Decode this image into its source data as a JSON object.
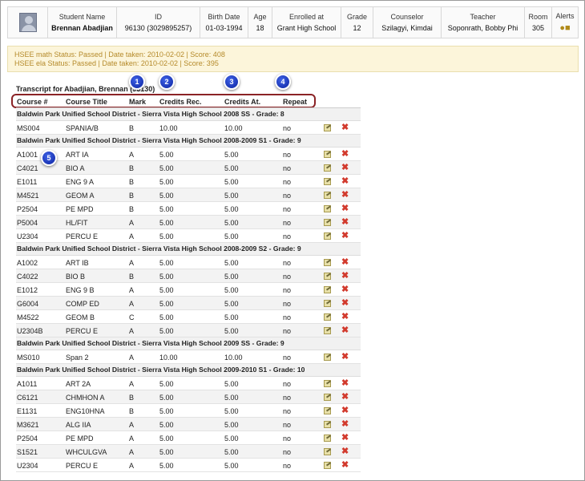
{
  "header": {
    "columns": [
      {
        "label": "Student Name",
        "value": "Brennan Abadjian"
      },
      {
        "label": "ID",
        "value": "96130 (3029895257)"
      },
      {
        "label": "Birth Date",
        "value": "01-03-1994"
      },
      {
        "label": "Age",
        "value": "18"
      },
      {
        "label": "Enrolled at",
        "value": "Grant High School"
      },
      {
        "label": "Grade",
        "value": "12"
      },
      {
        "label": "Counselor",
        "value": "Szilagyi, Kimdai"
      },
      {
        "label": "Teacher",
        "value": "Soponrath, Bobby Phi"
      },
      {
        "label": "Room",
        "value": "305"
      },
      {
        "label": "Alerts",
        "value": ""
      }
    ]
  },
  "hsee": {
    "line1": "HSEE math Status: Passed | Date taken: 2010-02-02 | Score: 408",
    "line2": "HSEE ela Status: Passed | Date taken: 2010-02-02 | Score: 395"
  },
  "transcript": {
    "title": "Transcript for Abadjian, Brennan (96130)",
    "columns": [
      "Course #",
      "Course Title",
      "Mark",
      "Credits Rec.",
      "Credits At.",
      "Repeat"
    ],
    "sections": [
      {
        "school": "Baldwin Park Unified School District - Sierra Vista High School 2008 SS - Grade: 8",
        "rows": [
          [
            "MS004",
            "SPANIA/B",
            "B",
            "10.00",
            "10.00",
            "no"
          ]
        ]
      },
      {
        "school": "Baldwin Park Unified School District - Sierra Vista High School 2008-2009 S1 - Grade: 9",
        "rows": [
          [
            "A1001",
            "ART IA",
            "A",
            "5.00",
            "5.00",
            "no"
          ],
          [
            "C4021",
            "BIO A",
            "B",
            "5.00",
            "5.00",
            "no"
          ],
          [
            "E1011",
            "ENG 9 A",
            "B",
            "5.00",
            "5.00",
            "no"
          ],
          [
            "M4521",
            "GEOM A",
            "B",
            "5.00",
            "5.00",
            "no"
          ],
          [
            "P2504",
            "PE MPD",
            "B",
            "5.00",
            "5.00",
            "no"
          ],
          [
            "P5004",
            "HL/FIT",
            "A",
            "5.00",
            "5.00",
            "no"
          ],
          [
            "U2304",
            "PERCU E",
            "A",
            "5.00",
            "5.00",
            "no"
          ]
        ]
      },
      {
        "school": "Baldwin Park Unified School District - Sierra Vista High School 2008-2009 S2 - Grade: 9",
        "rows": [
          [
            "A1002",
            "ART IB",
            "A",
            "5.00",
            "5.00",
            "no"
          ],
          [
            "C4022",
            "BIO B",
            "B",
            "5.00",
            "5.00",
            "no"
          ],
          [
            "E1012",
            "ENG 9 B",
            "A",
            "5.00",
            "5.00",
            "no"
          ],
          [
            "G6004",
            "COMP ED",
            "A",
            "5.00",
            "5.00",
            "no"
          ],
          [
            "M4522",
            "GEOM B",
            "C",
            "5.00",
            "5.00",
            "no"
          ],
          [
            "U2304B",
            "PERCU E",
            "A",
            "5.00",
            "5.00",
            "no"
          ]
        ]
      },
      {
        "school": "Baldwin Park Unified School District - Sierra Vista High School 2009 SS - Grade: 9",
        "rows": [
          [
            "MS010",
            "Span 2",
            "A",
            "10.00",
            "10.00",
            "no"
          ]
        ]
      },
      {
        "school": "Baldwin Park Unified School District - Sierra Vista High School 2009-2010 S1 - Grade: 10",
        "rows": [
          [
            "A1011",
            "ART 2A",
            "A",
            "5.00",
            "5.00",
            "no"
          ],
          [
            "C6121",
            "CHMHON A",
            "B",
            "5.00",
            "5.00",
            "no"
          ],
          [
            "E1131",
            "ENG10HNA",
            "B",
            "5.00",
            "5.00",
            "no"
          ],
          [
            "M3621",
            "ALG IIA",
            "A",
            "5.00",
            "5.00",
            "no"
          ],
          [
            "P2504",
            "PE MPD",
            "A",
            "5.00",
            "5.00",
            "no"
          ],
          [
            "S1521",
            "WHCULGVA",
            "A",
            "5.00",
            "5.00",
            "no"
          ],
          [
            "U2304",
            "PERCU E",
            "A",
            "5.00",
            "5.00",
            "no"
          ]
        ]
      }
    ]
  },
  "callouts": [
    "1",
    "2",
    "3",
    "4",
    "5"
  ]
}
